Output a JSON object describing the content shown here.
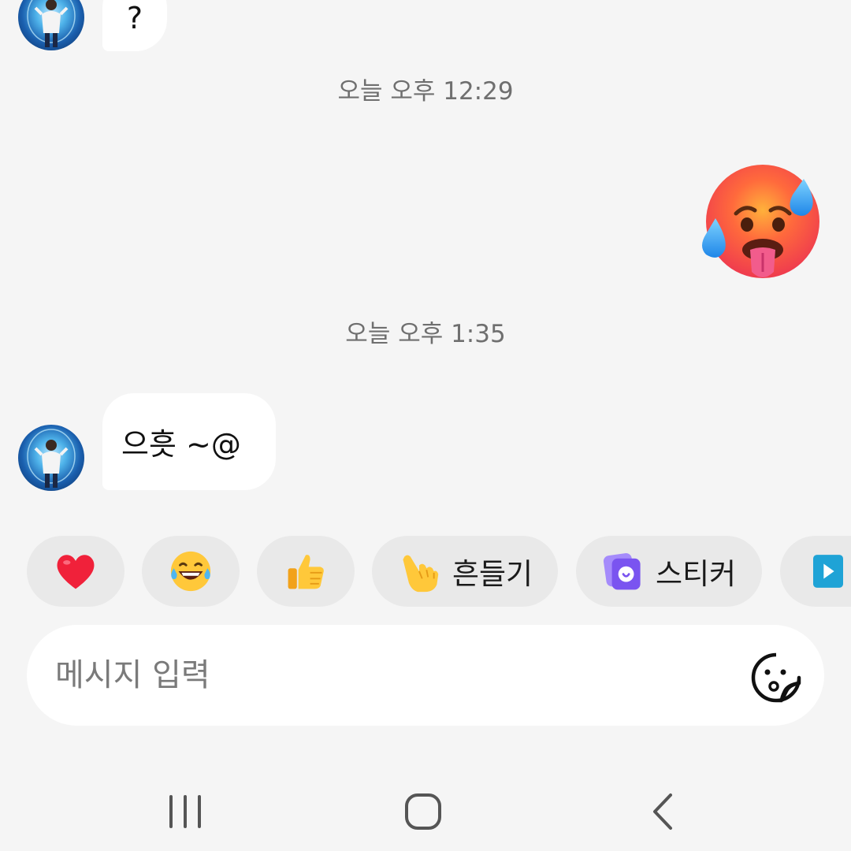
{
  "messages": [
    {
      "sender": "other",
      "text": "?"
    },
    {
      "timestamp": "오늘 오후 12:29"
    },
    {
      "sender": "me",
      "emoji": "hot-face-emoji"
    },
    {
      "timestamp": "오늘 오후 1:35"
    },
    {
      "sender": "other",
      "text": "으흣 ~@"
    }
  ],
  "quick_reactions": [
    {
      "icon": "heart-emoji"
    },
    {
      "icon": "tears-of-joy-emoji"
    },
    {
      "icon": "thumbs-up-emoji"
    },
    {
      "icon": "pointing-hand-emoji",
      "label": "흔들기"
    },
    {
      "icon": "sticker-app-icon",
      "label": "스티커"
    },
    {
      "icon": "play-app-icon"
    }
  ],
  "composer": {
    "placeholder": "메시지 입력",
    "sticker_icon": "sticker-face-icon"
  },
  "navigation": [
    "recent-apps-icon",
    "home-icon",
    "back-icon"
  ],
  "colors": {
    "background": "#f5f5f5",
    "bubble": "#ffffff",
    "chip": "#e9e9e9",
    "timestamp": "#6f6f6f",
    "sticker_purple": "#8b6cf6"
  }
}
